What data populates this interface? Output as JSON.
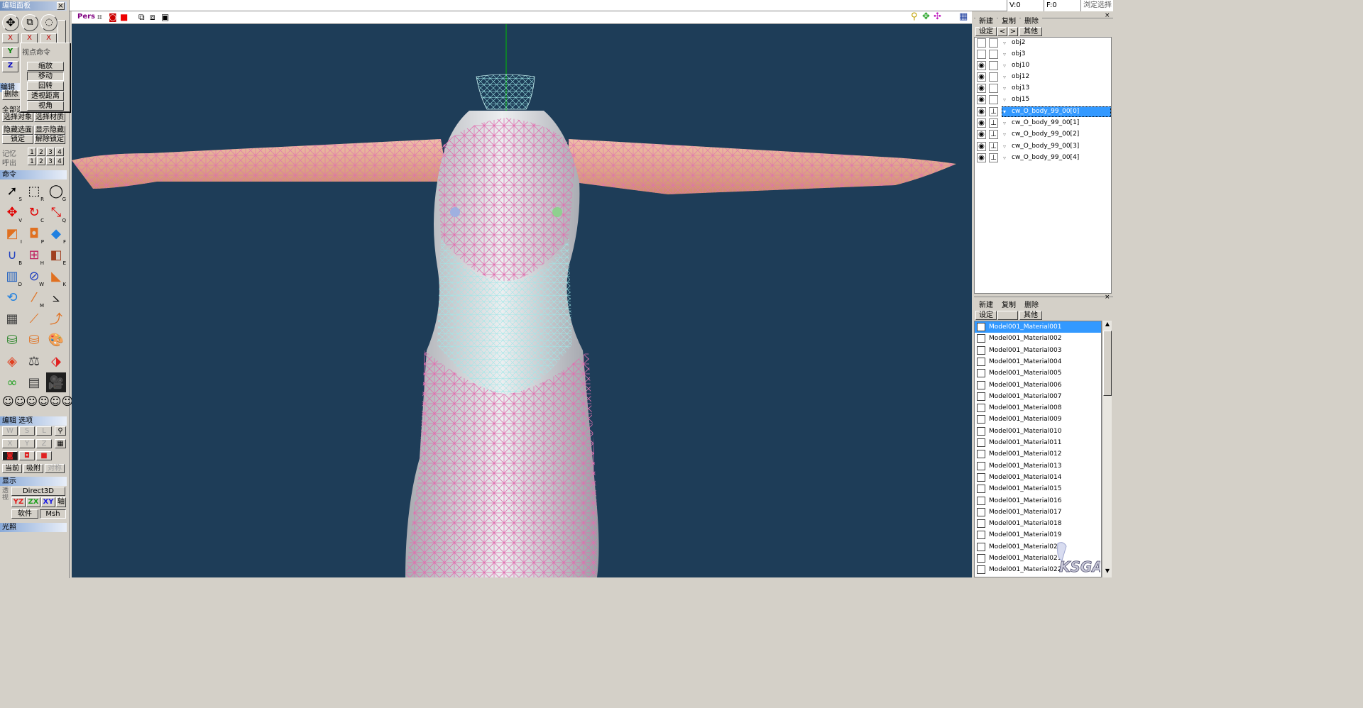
{
  "topbar": {
    "v": "V:0",
    "f": "F:0",
    "lock": "浏定选择"
  },
  "left_panel": {
    "title": "编辑面板",
    "axis": {
      "x": "X",
      "y": "Y",
      "z": "Z",
      "xr": "x"
    },
    "edit_partial": "编辑",
    "delete_partial": "删除",
    "select_all": "全部选",
    "select_object": "选择对象",
    "select_material": "选择材质",
    "hide_selected": "隐藏选面",
    "show_hidden": "显示隐藏",
    "lock": "锁定",
    "unlock": "解除锁定",
    "memory_label": "记忆",
    "recall_label": "呼出",
    "slots": [
      "1",
      "2",
      "3",
      "4"
    ],
    "command_title": "命令",
    "tool_keys": [
      "S",
      "R",
      "G",
      "V",
      "C",
      "Q",
      "I",
      "P",
      "F",
      "B",
      "H",
      "E",
      "D",
      "W",
      "K",
      "",
      "M",
      "",
      "",
      "",
      "",
      "",
      "",
      "",
      "",
      "",
      ""
    ],
    "edit_options_title": "编辑 选项",
    "opt_w": "W",
    "opt_s": "S",
    "opt_l": "L",
    "opt_x": "X",
    "opt_y": "Y",
    "opt_z": "Z",
    "current": "当前",
    "snap": "吸附",
    "symmetry": "对称",
    "display_title": "显示",
    "direct3d": "Direct3D",
    "yz": "YZ",
    "zx": "ZX",
    "xy": "XY",
    "axis_btn": "轴",
    "software": "软件",
    "msh": "Msh",
    "light_title": "光照",
    "side_labels": [
      "透",
      "视"
    ]
  },
  "popup": {
    "title": "视点命令",
    "items": [
      "缩放",
      "移动",
      "回转",
      "透视距离",
      "视角"
    ]
  },
  "viewport": {
    "mode": "Pers"
  },
  "objects": {
    "buttons": {
      "new": "新建",
      "copy": "复制",
      "delete": "删除",
      "settings": "设定",
      "prev": "<",
      "next": ">",
      "other": "其他"
    },
    "rows": [
      {
        "name": "obj2",
        "visible": false,
        "locked": false,
        "selected": false
      },
      {
        "name": "obj3",
        "visible": false,
        "locked": false,
        "selected": false
      },
      {
        "name": "obj10",
        "visible": true,
        "locked": false,
        "selected": false
      },
      {
        "name": "obj12",
        "visible": true,
        "locked": false,
        "selected": false
      },
      {
        "name": "obj13",
        "visible": true,
        "locked": false,
        "selected": false
      },
      {
        "name": "obj15",
        "visible": true,
        "locked": false,
        "selected": false
      },
      {
        "name": "cw_O_body_99_00[0]",
        "visible": true,
        "locked": true,
        "selected": true
      },
      {
        "name": "cw_O_body_99_00[1]",
        "visible": true,
        "locked": true,
        "selected": false
      },
      {
        "name": "cw_O_body_99_00[2]",
        "visible": true,
        "locked": true,
        "selected": false
      },
      {
        "name": "cw_O_body_99_00[3]",
        "visible": true,
        "locked": true,
        "selected": false
      },
      {
        "name": "cw_O_body_99_00[4]",
        "visible": true,
        "locked": true,
        "selected": false
      }
    ]
  },
  "materials": {
    "buttons": {
      "new": "新建",
      "copy": "复制",
      "delete": "删除",
      "settings": "设定",
      "other": "其他"
    },
    "rows": [
      "Model001_Material001",
      "Model001_Material002",
      "Model001_Material003",
      "Model001_Material004",
      "Model001_Material005",
      "Model001_Material006",
      "Model001_Material007",
      "Model001_Material008",
      "Model001_Material009",
      "Model001_Material010",
      "Model001_Material011",
      "Model001_Material012",
      "Model001_Material013",
      "Model001_Material014",
      "Model001_Material015",
      "Model001_Material016",
      "Model001_Material017",
      "Model001_Material018",
      "Model001_Material019",
      "Model001_Material020",
      "Model001_Material021",
      "Model001_Material022"
    ],
    "selected_index": 0
  },
  "colors": {
    "wire_pink": "#e070b0",
    "wire_cyan": "#9ee8e8",
    "viewport_bg": "#1e3d58",
    "selection": "#3399ff"
  },
  "watermark": "KSGAL"
}
